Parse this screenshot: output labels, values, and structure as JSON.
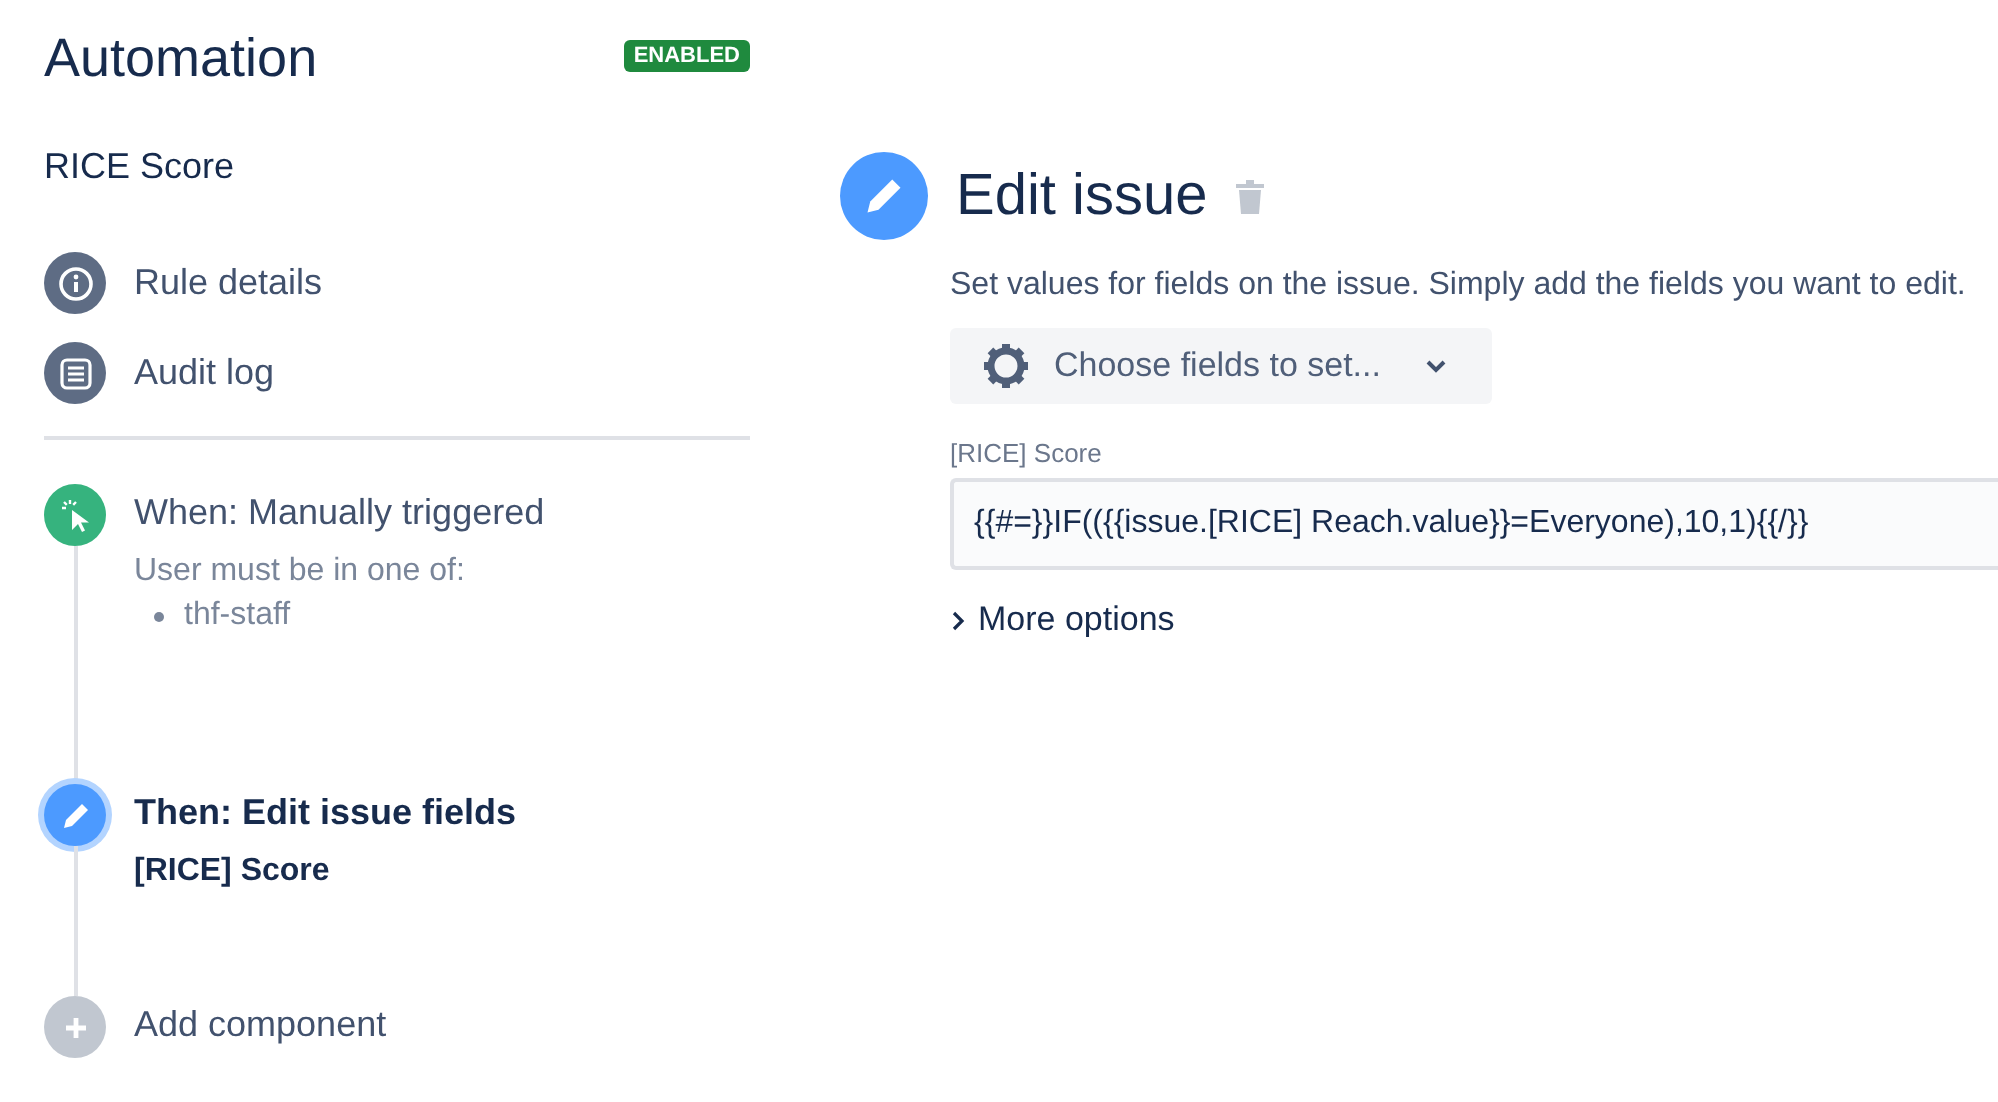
{
  "header": {
    "title": "Automation",
    "status": "ENABLED"
  },
  "rule_name": "RICE Score",
  "nav": [
    {
      "kind": "info",
      "label": "Rule details"
    },
    {
      "kind": "log",
      "label": "Audit log"
    }
  ],
  "steps": [
    {
      "kind": "trigger",
      "title": "When: Manually triggered",
      "selected": false,
      "details": "User must be in one of:",
      "bullets": [
        "thf-staff"
      ]
    },
    {
      "kind": "action",
      "title": "Then: Edit issue fields",
      "selected": true,
      "details": "[RICE] Score"
    },
    {
      "kind": "add",
      "title": "Add component",
      "selected": false
    }
  ],
  "panel": {
    "title": "Edit issue",
    "description": "Set values for fields on the issue. Simply add the fields you want to edit.",
    "choose_button": "Choose fields to set...",
    "field_label": "[RICE] Score",
    "field_value": "{{#=}}IF(({{issue.[RICE] Reach.value}}=Everyone),10,1){{/}}",
    "more_options": "More options"
  }
}
